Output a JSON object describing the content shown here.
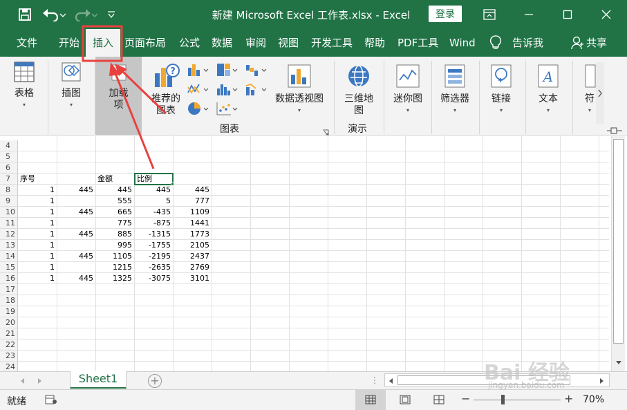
{
  "titlebar": {
    "title": "新建 Microsoft Excel 工作表.xlsx  -  Excel",
    "login_label": "登录",
    "save_icon": "save-icon",
    "undo_icon": "undo-icon",
    "redo_icon": "redo-icon",
    "customize_icon": "customize-qat-icon"
  },
  "tabs": [
    "文件",
    "开始",
    "插入",
    "页面布局",
    "公式",
    "数据",
    "审阅",
    "视图",
    "开发工具",
    "帮助",
    "PDF工具",
    "Wind",
    "告诉我",
    "共享"
  ],
  "active_tab": "插入",
  "ribbon": {
    "table": "表格",
    "illustrations": "插图",
    "addins_1": "加载",
    "addins_2": "项",
    "recommended_1": "推荐的",
    "recommended_2": "图表",
    "pivot_chart": "数据透视图",
    "map3d_1": "三维地",
    "map3d_2": "图",
    "sparklines": "迷你图",
    "filters": "筛选器",
    "links": "链接",
    "text": "文本",
    "symbols_partial": "符",
    "group_charts": "图表",
    "group_tours": "演示",
    "dropdown_caret": "▾"
  },
  "sheet": {
    "row_numbers": [
      "4",
      "5",
      "6",
      "7",
      "8",
      "9",
      "10",
      "11",
      "12",
      "13",
      "14",
      "15",
      "16",
      "17",
      "18",
      "19",
      "20",
      "21",
      "22",
      "23",
      "24"
    ],
    "header_row": {
      "a": "序号",
      "c": "金额",
      "d": "比例"
    },
    "rows": [
      {
        "a": "1",
        "b": "445",
        "c": "445",
        "d": "445",
        "e": "445"
      },
      {
        "a": "1",
        "b": "",
        "c": "555",
        "d": "5",
        "e": "777"
      },
      {
        "a": "1",
        "b": "445",
        "c": "665",
        "d": "-435",
        "e": "1109"
      },
      {
        "a": "1",
        "b": "",
        "c": "775",
        "d": "-875",
        "e": "1441"
      },
      {
        "a": "1",
        "b": "445",
        "c": "885",
        "d": "-1315",
        "e": "1773"
      },
      {
        "a": "1",
        "b": "",
        "c": "995",
        "d": "-1755",
        "e": "2105"
      },
      {
        "a": "1",
        "b": "445",
        "c": "1105",
        "d": "-2195",
        "e": "2437"
      },
      {
        "a": "1",
        "b": "",
        "c": "1215",
        "d": "-2635",
        "e": "2769"
      },
      {
        "a": "1",
        "b": "445",
        "c": "1325",
        "d": "-3075",
        "e": "3101"
      }
    ]
  },
  "sheet_tab": "Sheet1",
  "status": {
    "ready": "就绪",
    "zoom": "70%",
    "zoom_minus": "−",
    "zoom_plus": "+"
  },
  "watermark": {
    "brand": "Bai  经验",
    "url": "jingyan.baidu.com"
  },
  "colors": {
    "excel_green": "#217346",
    "annotation_red": "#e8413e",
    "ribbon_bg": "#f3f3f3"
  }
}
